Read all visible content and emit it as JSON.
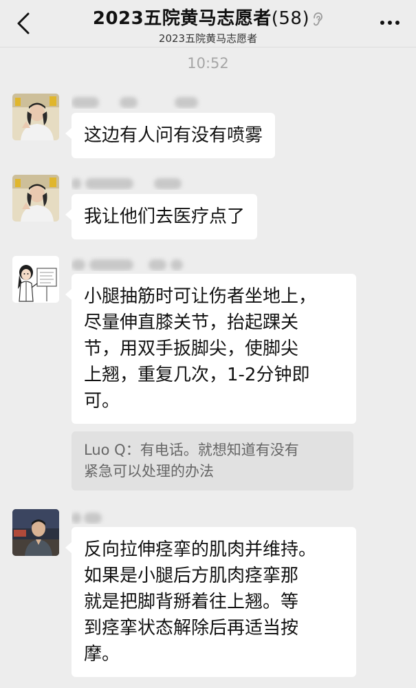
{
  "header": {
    "title": "2023五院黄马志愿者",
    "member_count": "(58)",
    "subtitle": "2023五院黄马志愿者",
    "back_icon": "chevron-left-icon",
    "mute_icon": "ear-icon",
    "more_icon": "more-dots-icon"
  },
  "timestamp": "10:52",
  "messages": [
    {
      "avatar": "avatar-woman-cap",
      "text": "这边有人问有没有喷雾"
    },
    {
      "avatar": "avatar-woman-cap",
      "text": "我让他们去医疗点了"
    },
    {
      "avatar": "avatar-doctor-cartoon",
      "text_lines": [
        "小腿抽筋时可让伤者坐地上，",
        "尽量伸直膝关节，抬起踝关",
        "节，用双手扳脚尖，使脚尖",
        "上翘，重复几次，1-2分钟即",
        "可。"
      ],
      "quote_lines": [
        "Luo Q：有电话。就想知道有没有",
        "紧急可以处理的办法"
      ]
    },
    {
      "avatar": "avatar-man-photo",
      "text_lines": [
        "反向拉伸痉挛的肌肉并维持。",
        "如果是小腿后方肌肉痉挛那",
        "就是把脚背掰着往上翘。等",
        "到痉挛状态解除后再适当按",
        "摩。"
      ]
    }
  ]
}
